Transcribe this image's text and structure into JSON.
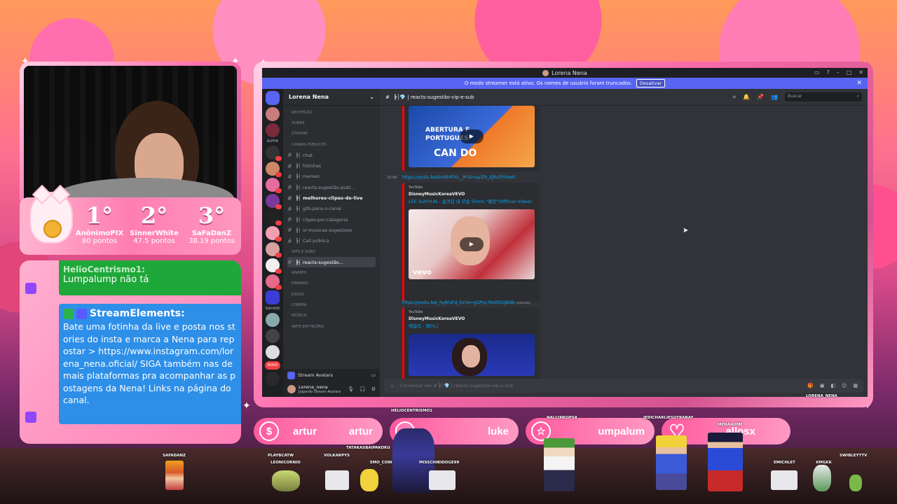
{
  "ranking": {
    "first": {
      "place": "1°",
      "name": "AnônimoPIX",
      "points": "80 pontos"
    },
    "second": {
      "place": "2°",
      "name": "SinnerWhite",
      "points": "47.5 pontos"
    },
    "third": {
      "place": "3°",
      "name": "SaFaDanZ",
      "points": "38.19 pontos"
    }
  },
  "chat": {
    "cut_author": "HelioCentrismo1:",
    "msg1": "Lumpalump não tá",
    "author2": "StreamElements:",
    "msg2": "Bate uma fotinha da live e posta nos stories do insta e marca a Nena para repostar > https://www.instagram.com/lorena_nena.oficial/ SIGA também nas demais plataformas pra acompanhar as postagens da Nena! Links na página do canal."
  },
  "discord": {
    "window_title": "Lorena Nena",
    "banner_text": "O modo streamer está ativo. Os nomes de usuário foram truncados.",
    "banner_button": "Desativar",
    "guild_name": "Lorena Nena",
    "server_label_alpha": "ALPHA",
    "server_label_sdm": "Sdm0d5",
    "server_label_novo": "NOVO",
    "channel_header": "┣│💎 | reacts-sugestão-vip-e-sub",
    "search_placeholder": "Buscar",
    "channels": [
      {
        "label": "RECEPÇÃO",
        "kind": "category"
      },
      {
        "label": "SOBRE",
        "kind": "category"
      },
      {
        "label": "STREAM",
        "kind": "category"
      },
      {
        "label": "CANAIS PÚBLICOS",
        "kind": "category"
      },
      {
        "label": "┣│ chat",
        "kind": "text"
      },
      {
        "label": "┣│ fotinhas",
        "kind": "text"
      },
      {
        "label": "┣│ memes",
        "kind": "text"
      },
      {
        "label": "┣│ reacts-sugestão-publ...",
        "kind": "text"
      },
      {
        "label": "┣│ melhores-clipes-de-live",
        "kind": "bold"
      },
      {
        "label": "┣│ gifs-para-o-canal",
        "kind": "text"
      },
      {
        "label": "┣│ clipes-por-categoria",
        "kind": "text"
      },
      {
        "label": "┣│ vr-musicas-sugestoes",
        "kind": "text"
      },
      {
        "label": "┣│ Call pública",
        "kind": "text"
      },
      {
        "label": "VIPS E SUBS",
        "kind": "category"
      },
      {
        "label": "┣│ reacts-sugestão...",
        "kind": "active"
      },
      {
        "label": "ANIMES",
        "kind": "category"
      },
      {
        "label": "DRAMAS",
        "kind": "category"
      },
      {
        "label": "JOGOS",
        "kind": "category"
      },
      {
        "label": "CINEMA",
        "kind": "category"
      },
      {
        "label": "MÚSICA",
        "kind": "category"
      },
      {
        "label": "ARTE EM FELTRO",
        "kind": "category"
      }
    ],
    "voice_label": "Stream Avatars",
    "user_name": "Lorena_nena",
    "user_status": "Jogando Stream Avatars",
    "msg1_thumb_line1": "ABERTURA F",
    "msg1_thumb_line2": "PORTUGUES",
    "msg1_thumb_line3": "CAN DO",
    "msg2_time": "23:49",
    "msg2_link": "https://youtu.be/Uml94FXs__M?si=ayZlh_EjRuOYrbwG",
    "msg2_provider": "YouTube",
    "msg2_author": "DisneyMusicKoreaVEVO",
    "msg2_title": "LEE SUHYUN - 숨겨진 내 모습 (From \"뮬란\"/Official Video)",
    "msg2_watermark": "vevo",
    "msg3_link": "https://youtu.be/_hy8FsFd_5o?si=gGPny76U0O1jBtdk",
    "msg3_edited": "(editado)",
    "msg3_provider": "YouTube",
    "msg3_author": "DisneyMusicKoreaVEVO",
    "msg3_title": "에일리 - 페어니",
    "composer_placeholder": "Conversar em # ┣│💎 | reacts-sugestão-vip-e-sub"
  },
  "alerts": {
    "pill1": "artur",
    "pill1b": "artur",
    "pill2": "luke",
    "pill3": "umpalum",
    "pill4": "allosx"
  },
  "avatars": {
    "helio": "HELIOCENTRISMO1",
    "safadanz": "SAFADANZ",
    "playbcatw": "PLAYBCATW",
    "leonicornio": "LEONICORNIO",
    "volkarpys": "VOLKARPYS",
    "tatakas": "TATAKASBAIPAKOKU",
    "emo": "EMO_COWBOY",
    "missbi": "MISSCHIBIDOGE99",
    "nalcinko": "NALCINKOPS8",
    "jedichar": "JEDICHARLIESUTRABAY",
    "menaahme": "MENAAHME",
    "lorena": "LORENA_NENA",
    "emichlet": "EMICHLET",
    "xmgkk": "XMGKK",
    "swibley": "SWIBLEYTTV"
  }
}
